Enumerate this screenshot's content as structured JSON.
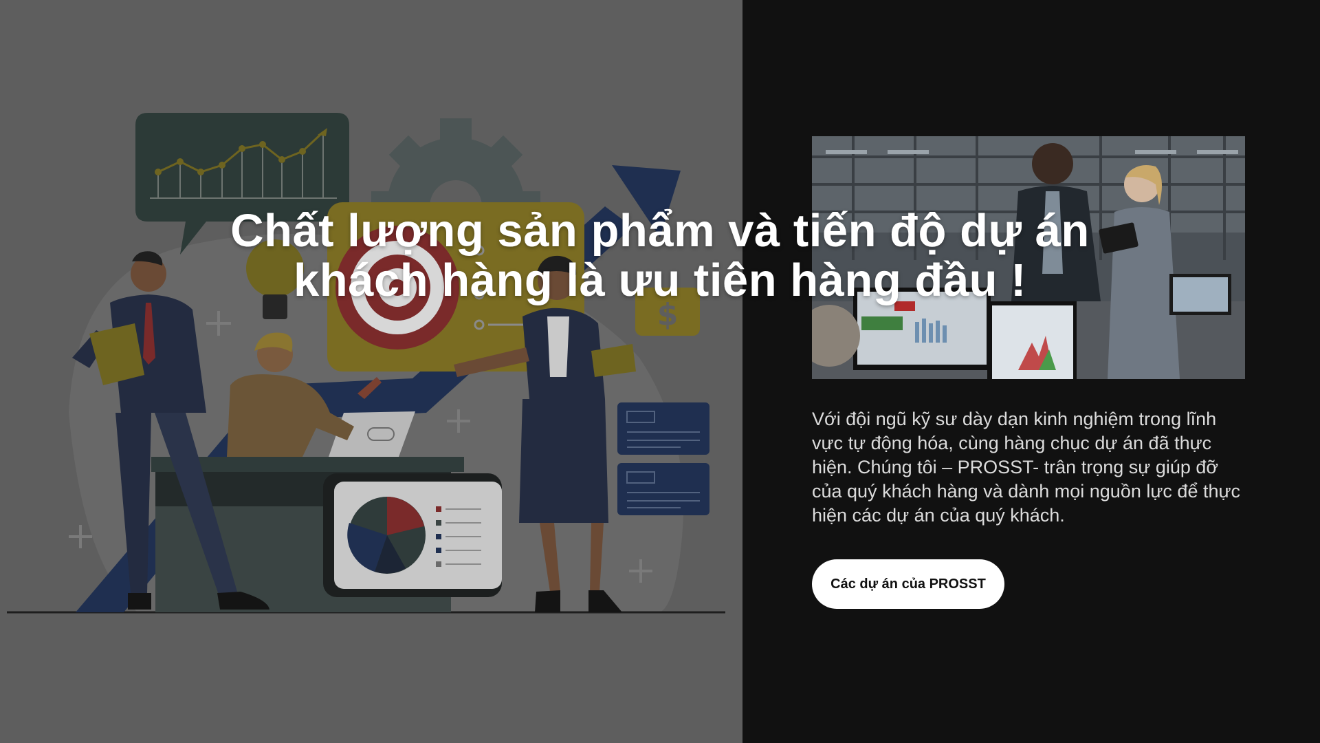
{
  "hero": {
    "headline_line1": "Chất lượng sản phẩm và tiến độ dự án",
    "headline_line2": "khách hàng là ưu tiên hàng đầu !"
  },
  "content": {
    "body": "Với đội ngũ kỹ sư dày dạn kinh nghiệm trong lĩnh vực tự động hóa, cùng hàng chục dự án đã thực hiện. Chúng tôi – PROSST- trân trọng sự giúp đỡ của quý khách hàng và dành mọi nguồn lực để thực hiện các dự án của quý khách.",
    "cta_label": "Các dự án của PROSST"
  },
  "illustration": {
    "dollar_sign": "$"
  },
  "colors": {
    "left_background": "#5e5e5e",
    "right_background": "#111111",
    "cta_background": "#ffffff",
    "cta_text": "#111111",
    "accent_mustard": "#8a7a28",
    "accent_navy": "#1f2f50",
    "accent_red": "#8a2d2d"
  }
}
